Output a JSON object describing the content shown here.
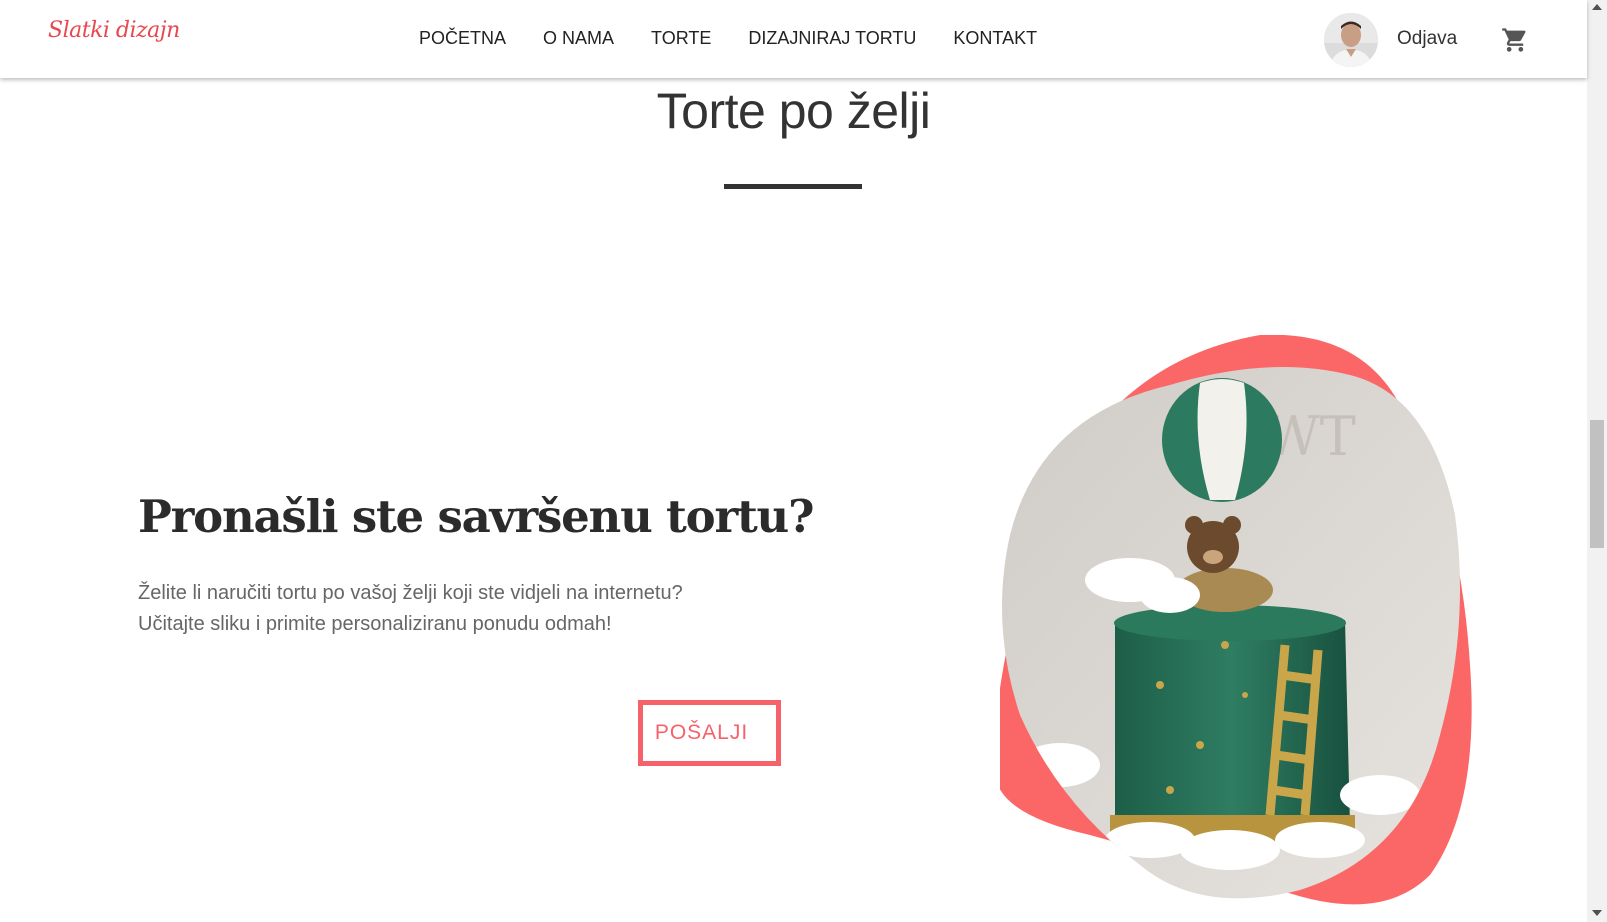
{
  "header": {
    "logo": "Slatki dizajn",
    "nav": [
      {
        "label": "POČETNA"
      },
      {
        "label": "O NAMA"
      },
      {
        "label": "TORTE"
      },
      {
        "label": "DIZAJNIRAJ TORTU"
      },
      {
        "label": "KONTAKT"
      }
    ],
    "logout_label": "Odjava",
    "cart_icon": "shopping-cart-icon",
    "avatar_icon": "user-avatar"
  },
  "section": {
    "title": "Torte po želji"
  },
  "promo": {
    "heading": "Pronašli ste savršenu tortu?",
    "line1": "Želite li naručiti tortu po vašoj želji koji ste vidjeli na internetu?",
    "line2": "Učitajte sliku i primite personaliziranu ponudu odmah!",
    "button_label": "POŠALJI"
  },
  "colors": {
    "accent": "#f6626a",
    "logo": "#e8484f",
    "text_dark": "#333333",
    "text_muted": "#666666"
  }
}
